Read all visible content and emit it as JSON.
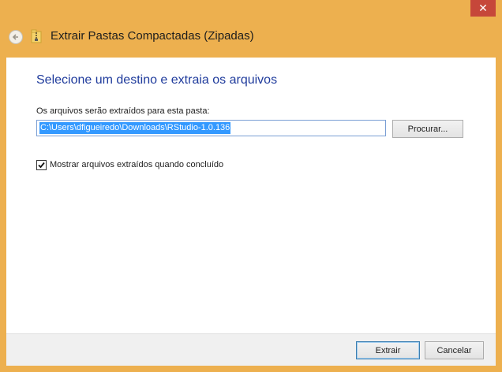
{
  "window": {
    "title": "Extrair Pastas Compactadas (Zipadas)",
    "close_glyph": "✕"
  },
  "main": {
    "heading": "Selecione um destino e extraia os arquivos",
    "path_label": "Os arquivos serão extraídos para esta pasta:",
    "path_value": "C:\\Users\\dfigueiredo\\Downloads\\RStudio-1.0.136",
    "browse_label": "Procurar...",
    "show_files_checked": true,
    "show_files_label": "Mostrar arquivos extraídos quando concluído"
  },
  "footer": {
    "extract_label": "Extrair",
    "cancel_label": "Cancelar"
  },
  "colors": {
    "frame": "#edb04f",
    "close": "#c6473a",
    "heading": "#1f3b9c",
    "selection": "#3399ff"
  },
  "icons": {
    "back": "back-arrow-icon",
    "zip": "zip-folder-icon",
    "check": "checkmark-icon"
  }
}
